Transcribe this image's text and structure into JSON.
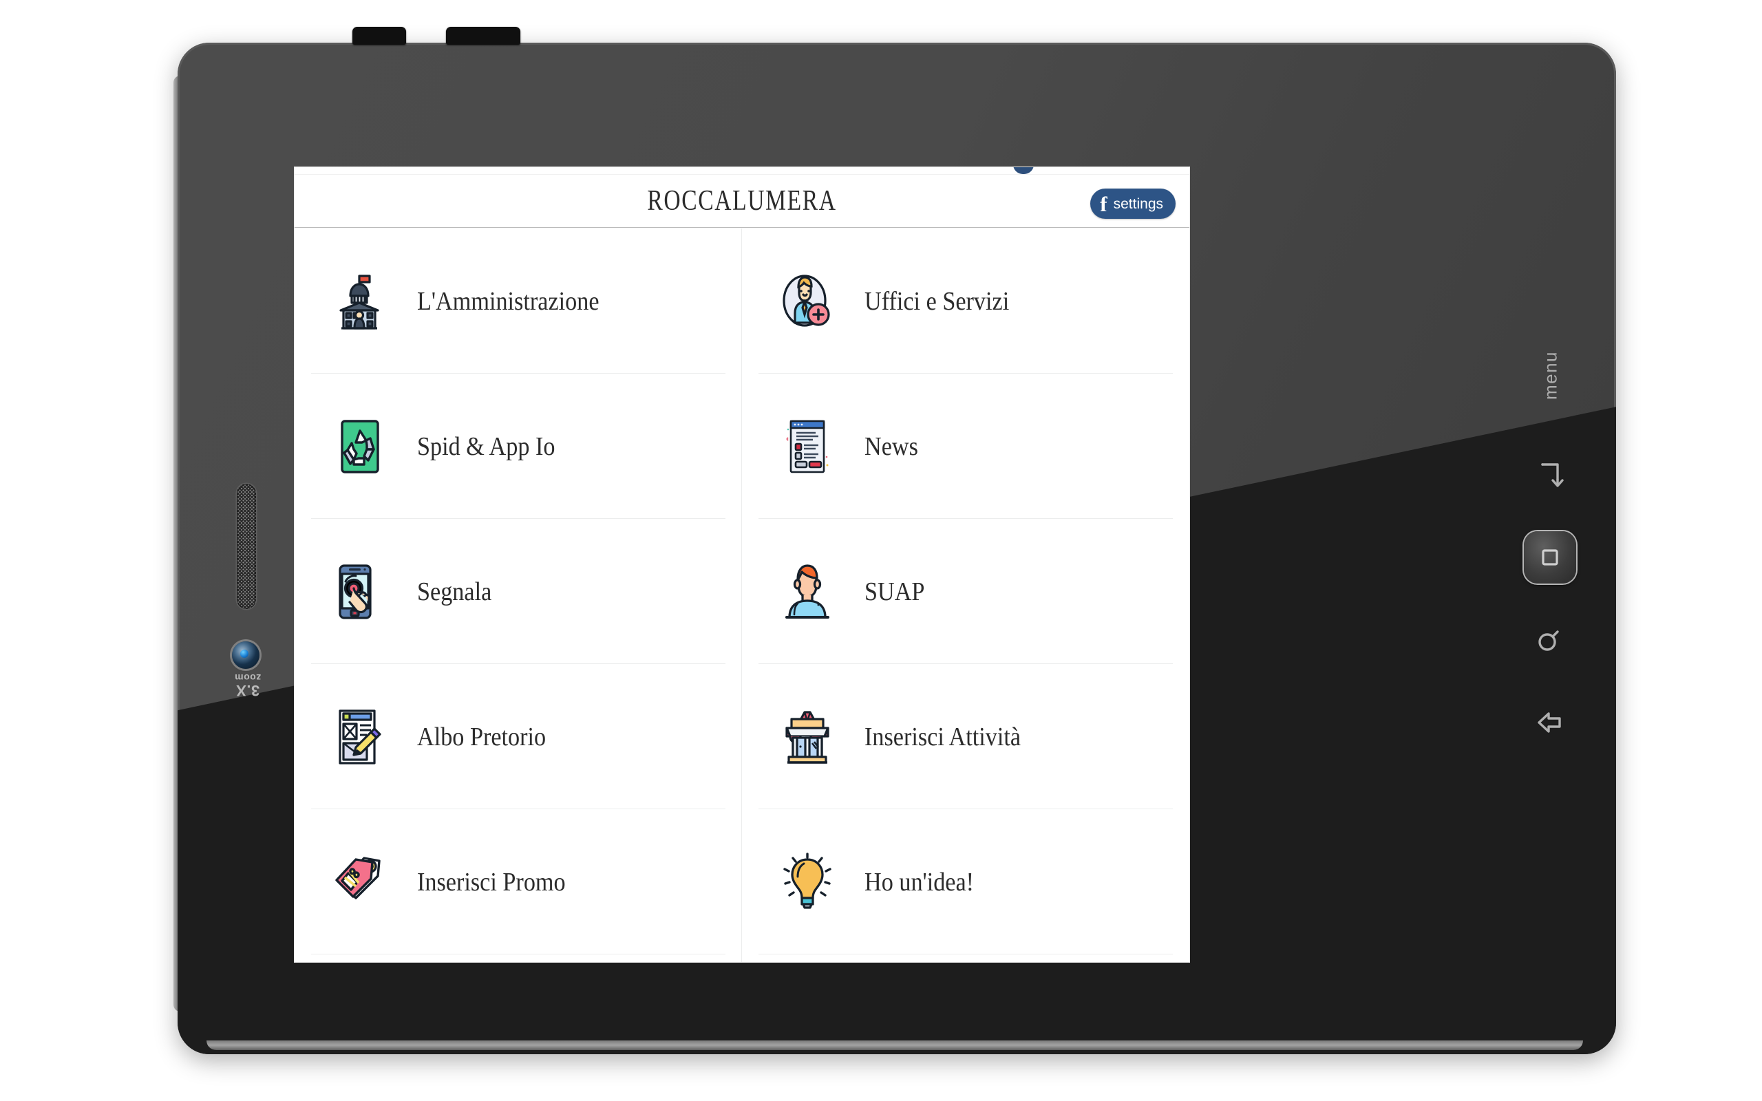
{
  "device": {
    "left_side": {
      "speaker_grille_name": "speaker-grille",
      "camera_name": "camera-lens",
      "zoom_big": "3.X",
      "zoom_small": "zoom"
    },
    "right_side": {
      "menu_label": "menu",
      "nav_buttons": [
        {
          "name": "recent-apps-icon",
          "label": "recent"
        },
        {
          "name": "home-icon",
          "label": "home"
        },
        {
          "name": "search-icon",
          "label": "search"
        },
        {
          "name": "back-icon",
          "label": "back"
        }
      ]
    },
    "top_buttons": [
      {
        "name": "volume-button",
        "label": "volume"
      },
      {
        "name": "power-button",
        "label": "power"
      }
    ]
  },
  "screen": {
    "appbar": {
      "title": "ROCCALUMERA",
      "settings_button": {
        "label": "settings",
        "icon": "facebook-f-icon",
        "glyph": "f",
        "background": "#2d5486"
      }
    },
    "menu": {
      "items": [
        {
          "label": "L'Amministrazione",
          "icon": "government-building-icon"
        },
        {
          "label": "Uffici e Servizi",
          "icon": "user-add-icon"
        },
        {
          "label": "Spid & App Io",
          "icon": "recycle-icon"
        },
        {
          "label": "News",
          "icon": "news-window-icon"
        },
        {
          "label": "Segnala",
          "icon": "smartphone-tap-icon"
        },
        {
          "label": "SUAP",
          "icon": "person-icon"
        },
        {
          "label": "Albo Pretorio",
          "icon": "document-pencil-icon"
        },
        {
          "label": "Inserisci Attività",
          "icon": "storefront-icon"
        },
        {
          "label": "Inserisci Promo",
          "icon": "price-tag-icon"
        },
        {
          "label": "Ho un'idea!",
          "icon": "lightbulb-icon"
        }
      ]
    },
    "colors": {
      "accent_blue": "#2d5486",
      "divider": "#eceded",
      "appbar_border": "#b9b9b9",
      "text": "#2c2c2c",
      "background": "#ffffff"
    }
  }
}
